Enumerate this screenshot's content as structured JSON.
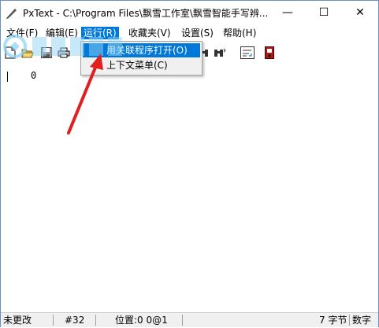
{
  "window": {
    "title": "PxText - C:\\Program Files\\飘雪工作室\\飘雪智能手写辨...",
    "minimize_glyph": "—",
    "maximize_glyph": "☐",
    "close_glyph": "✕"
  },
  "menu": {
    "file": "文件(F)",
    "edit": "编辑(E)",
    "run": "运行(R)",
    "favorites": "收藏夹(V)",
    "settings": "设置(S)",
    "help": "帮助(H)"
  },
  "run_menu": {
    "items": [
      "用关联程序打开(O)",
      "上下文菜单(C)"
    ]
  },
  "toolbar": {
    "icons": [
      "new-file-icon",
      "open-folder-icon",
      "save-icon",
      "print-icon",
      "find-icon",
      "find-next-icon",
      "word-wrap-icon",
      "exit-icon"
    ]
  },
  "editor": {
    "line_text": "0"
  },
  "status": {
    "modified": "未更改",
    "char_code": "#32",
    "position": "位置:0  0@1",
    "byte_count": "7 字节",
    "mode": "数字"
  },
  "colors": {
    "highlight": "#0078d7",
    "arrow": "#e02020"
  }
}
